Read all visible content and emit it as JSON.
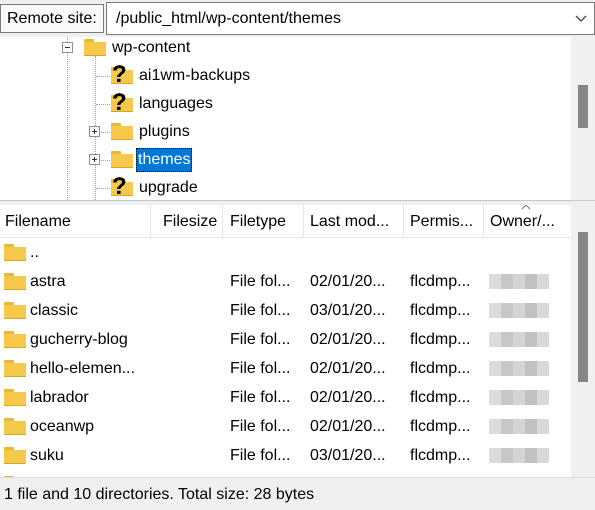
{
  "remote_site": {
    "label": "Remote site:",
    "path": "/public_html/wp-content/themes"
  },
  "tree": {
    "items": [
      {
        "label": "wp-content",
        "icon": "folder-icon",
        "expander": "minus"
      },
      {
        "label": "ai1wm-backups",
        "icon": "unknown-folder-icon",
        "expander": "none"
      },
      {
        "label": "languages",
        "icon": "unknown-folder-icon",
        "expander": "none"
      },
      {
        "label": "plugins",
        "icon": "folder-icon",
        "expander": "plus"
      },
      {
        "label": "themes",
        "icon": "folder-icon",
        "expander": "plus",
        "selected": true
      },
      {
        "label": "upgrade",
        "icon": "unknown-folder-icon",
        "expander": "none"
      }
    ]
  },
  "file_list": {
    "columns": [
      "Filename",
      "Filesize",
      "Filetype",
      "Last mod...",
      "Permis...",
      "Owner/..."
    ],
    "rows": [
      {
        "name": "..",
        "size": "",
        "type": "",
        "modified": "",
        "perms": "",
        "owner": ""
      },
      {
        "name": "astra",
        "size": "",
        "type": "File fol...",
        "modified": "02/01/20...",
        "perms": "flcdmp...",
        "owner": ""
      },
      {
        "name": "classic",
        "size": "",
        "type": "File fol...",
        "modified": "03/01/20...",
        "perms": "flcdmp...",
        "owner": ""
      },
      {
        "name": "gucherry-blog",
        "size": "",
        "type": "File fol...",
        "modified": "02/01/20...",
        "perms": "flcdmp...",
        "owner": ""
      },
      {
        "name": "hello-elemen...",
        "size": "",
        "type": "File fol...",
        "modified": "02/01/20...",
        "perms": "flcdmp...",
        "owner": ""
      },
      {
        "name": "labrador",
        "size": "",
        "type": "File fol...",
        "modified": "02/01/20...",
        "perms": "flcdmp...",
        "owner": ""
      },
      {
        "name": "oceanwp",
        "size": "",
        "type": "File fol...",
        "modified": "02/01/20...",
        "perms": "flcdmp...",
        "owner": ""
      },
      {
        "name": "suku",
        "size": "",
        "type": "File fol...",
        "modified": "03/01/20...",
        "perms": "flcdmp...",
        "owner": ""
      }
    ]
  },
  "status": {
    "text": "1 file and 10 directories. Total size: 28 bytes"
  },
  "colors": {
    "selection": "#0078d7",
    "folder": "#f7c94a",
    "scroll_thumb": "#858585"
  }
}
